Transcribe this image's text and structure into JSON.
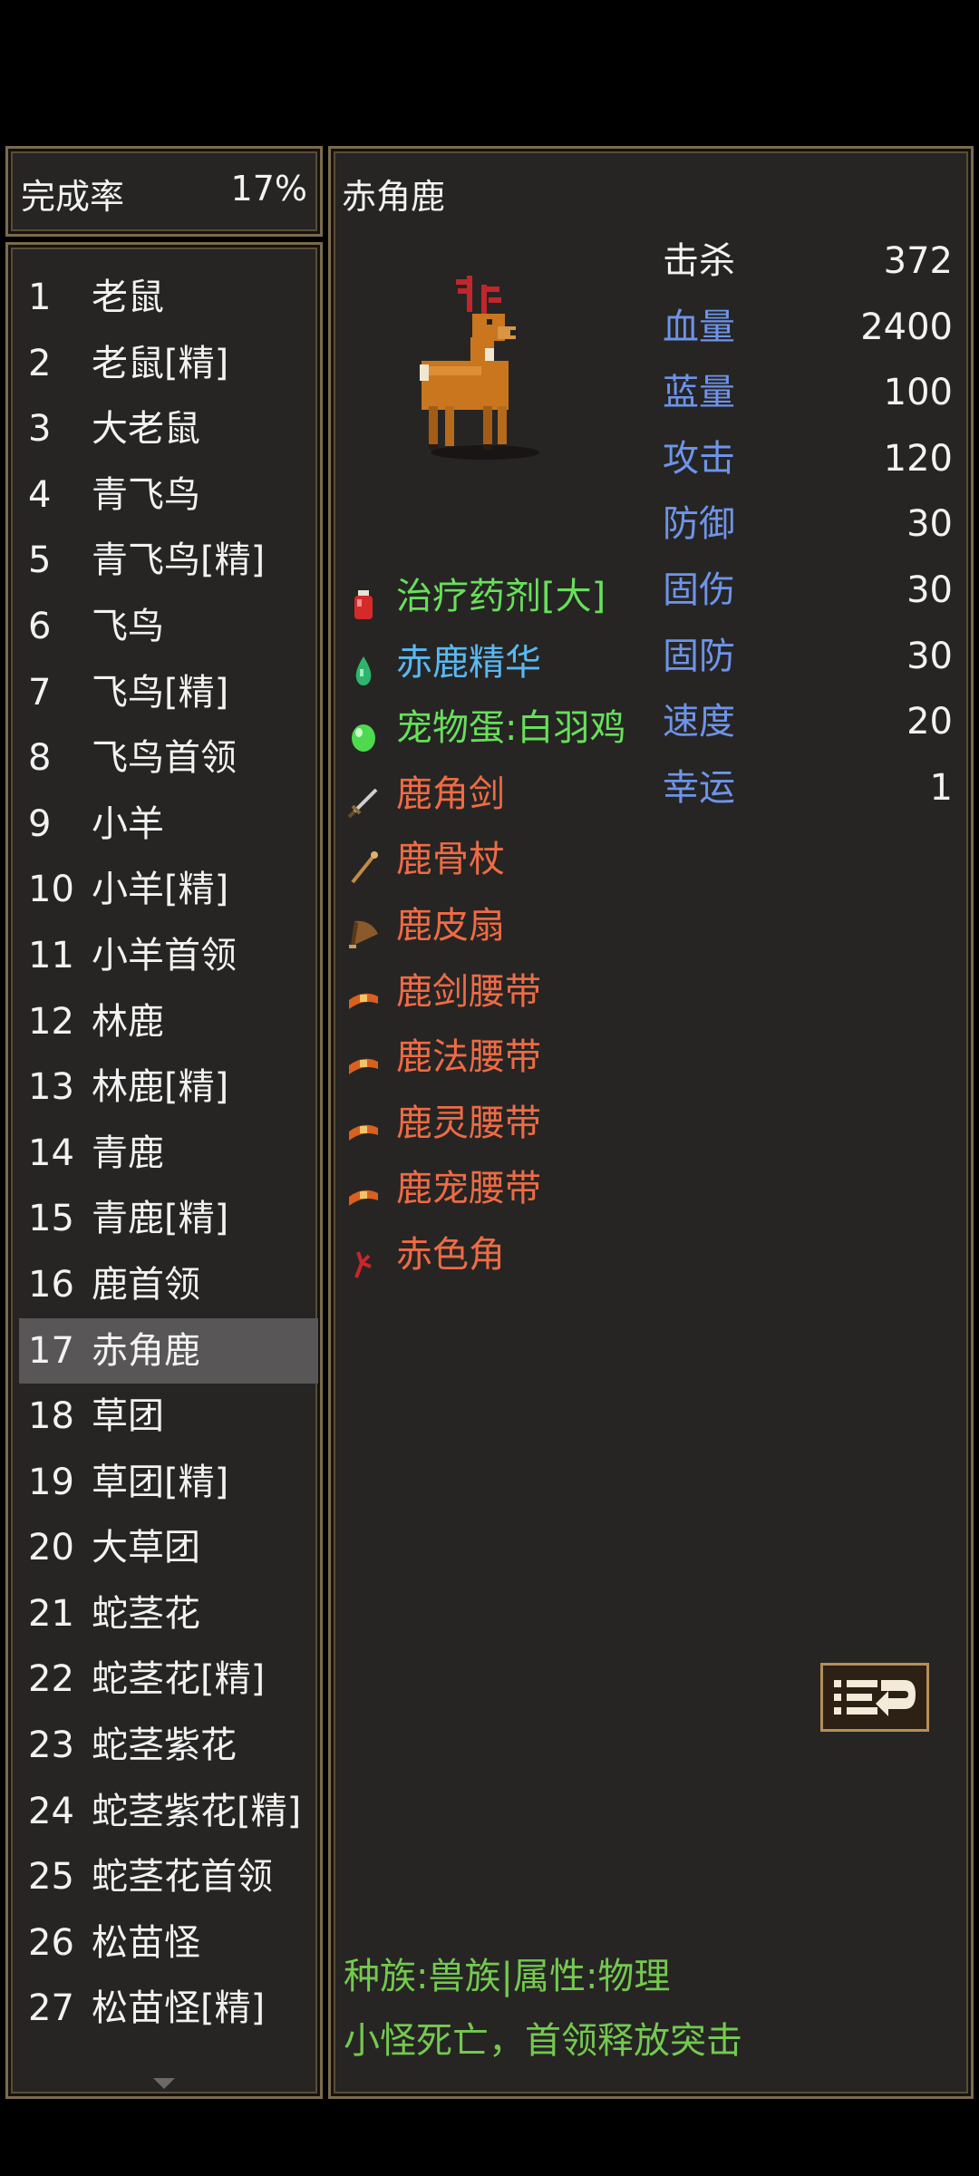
{
  "completion": {
    "label": "完成率",
    "value": "17%"
  },
  "monster_list": [
    {
      "num": "1",
      "name": "老鼠"
    },
    {
      "num": "2",
      "name": "老鼠[精]"
    },
    {
      "num": "3",
      "name": "大老鼠"
    },
    {
      "num": "4",
      "name": "青飞鸟"
    },
    {
      "num": "5",
      "name": "青飞鸟[精]"
    },
    {
      "num": "6",
      "name": "飞鸟"
    },
    {
      "num": "7",
      "name": "飞鸟[精]"
    },
    {
      "num": "8",
      "name": "飞鸟首领"
    },
    {
      "num": "9",
      "name": "小羊"
    },
    {
      "num": "10",
      "name": "小羊[精]"
    },
    {
      "num": "11",
      "name": "小羊首领"
    },
    {
      "num": "12",
      "name": "林鹿"
    },
    {
      "num": "13",
      "name": "林鹿[精]"
    },
    {
      "num": "14",
      "name": "青鹿"
    },
    {
      "num": "15",
      "name": "青鹿[精]"
    },
    {
      "num": "16",
      "name": "鹿首领"
    },
    {
      "num": "17",
      "name": "赤角鹿"
    },
    {
      "num": "18",
      "name": "草团"
    },
    {
      "num": "19",
      "name": "草团[精]"
    },
    {
      "num": "20",
      "name": "大草团"
    },
    {
      "num": "21",
      "name": "蛇茎花"
    },
    {
      "num": "22",
      "name": "蛇茎花[精]"
    },
    {
      "num": "23",
      "name": "蛇茎紫花"
    },
    {
      "num": "24",
      "name": "蛇茎紫花[精]"
    },
    {
      "num": "25",
      "name": "蛇茎花首领"
    },
    {
      "num": "26",
      "name": "松苗怪"
    },
    {
      "num": "27",
      "name": "松苗怪[精]"
    }
  ],
  "selected_index": 16,
  "monster": {
    "title": "赤角鹿",
    "stats": [
      {
        "label": "击杀",
        "value": "372"
      },
      {
        "label": "血量",
        "value": "2400"
      },
      {
        "label": "蓝量",
        "value": "100"
      },
      {
        "label": "攻击",
        "value": "120"
      },
      {
        "label": "防御",
        "value": "30"
      },
      {
        "label": "固伤",
        "value": "30"
      },
      {
        "label": "固防",
        "value": "30"
      },
      {
        "label": "速度",
        "value": "20"
      },
      {
        "label": "幸运",
        "value": "1"
      }
    ],
    "drops": [
      {
        "name": "治疗药剂[大]",
        "icon": "red-potion-icon",
        "color": "#67e05a"
      },
      {
        "name": "赤鹿精华",
        "icon": "green-essence-icon",
        "color": "#5ab8f0"
      },
      {
        "name": "宠物蛋:白羽鸡",
        "icon": "green-egg-icon",
        "color": "#67e05a"
      },
      {
        "name": "鹿角剑",
        "icon": "sword-icon",
        "color": "#ee6b45"
      },
      {
        "name": "鹿骨杖",
        "icon": "staff-icon",
        "color": "#ee6b45"
      },
      {
        "name": "鹿皮扇",
        "icon": "fan-icon",
        "color": "#ee6b45"
      },
      {
        "name": "鹿剑腰带",
        "icon": "belt-icon",
        "color": "#ee6b45"
      },
      {
        "name": "鹿法腰带",
        "icon": "belt-icon",
        "color": "#ee6b45"
      },
      {
        "name": "鹿灵腰带",
        "icon": "belt-icon",
        "color": "#ee6b45"
      },
      {
        "name": "鹿宠腰带",
        "icon": "belt-icon",
        "color": "#ee6b45"
      },
      {
        "name": "赤色角",
        "icon": "red-antler-icon",
        "color": "#ee6b45"
      }
    ],
    "race_line": "种族:兽族|属性:物理",
    "skill_line": "小怪死亡，首领释放突击"
  },
  "colors": {
    "panel_bg": "#262524",
    "panel_border": "#7b6a4e",
    "selected_row": "#585656",
    "stat_label": "#6e94ea",
    "footer_text": "#74c94f"
  }
}
